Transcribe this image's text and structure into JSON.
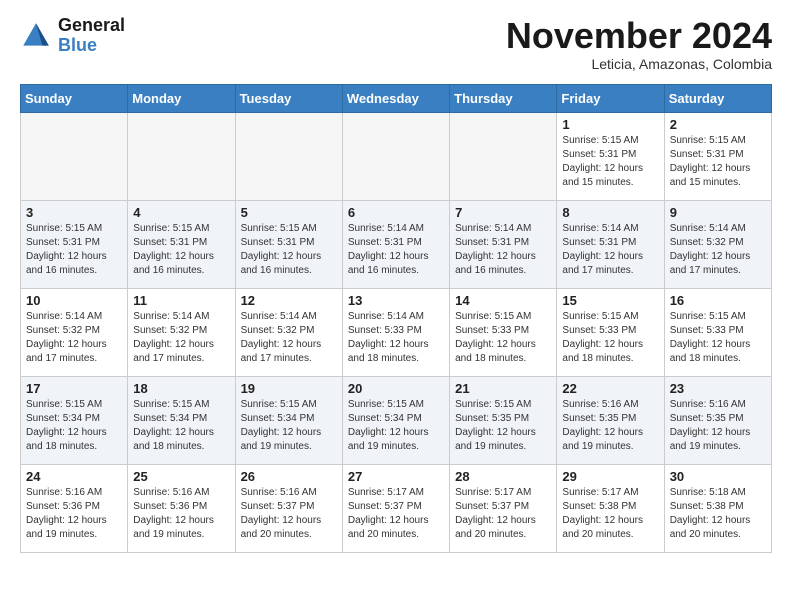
{
  "header": {
    "logo_line1": "General",
    "logo_line2": "Blue",
    "month": "November 2024",
    "location": "Leticia, Amazonas, Colombia"
  },
  "days_of_week": [
    "Sunday",
    "Monday",
    "Tuesday",
    "Wednesday",
    "Thursday",
    "Friday",
    "Saturday"
  ],
  "weeks": [
    [
      {
        "day": "",
        "info": ""
      },
      {
        "day": "",
        "info": ""
      },
      {
        "day": "",
        "info": ""
      },
      {
        "day": "",
        "info": ""
      },
      {
        "day": "",
        "info": ""
      },
      {
        "day": "1",
        "info": "Sunrise: 5:15 AM\nSunset: 5:31 PM\nDaylight: 12 hours\nand 15 minutes."
      },
      {
        "day": "2",
        "info": "Sunrise: 5:15 AM\nSunset: 5:31 PM\nDaylight: 12 hours\nand 15 minutes."
      }
    ],
    [
      {
        "day": "3",
        "info": "Sunrise: 5:15 AM\nSunset: 5:31 PM\nDaylight: 12 hours\nand 16 minutes."
      },
      {
        "day": "4",
        "info": "Sunrise: 5:15 AM\nSunset: 5:31 PM\nDaylight: 12 hours\nand 16 minutes."
      },
      {
        "day": "5",
        "info": "Sunrise: 5:15 AM\nSunset: 5:31 PM\nDaylight: 12 hours\nand 16 minutes."
      },
      {
        "day": "6",
        "info": "Sunrise: 5:14 AM\nSunset: 5:31 PM\nDaylight: 12 hours\nand 16 minutes."
      },
      {
        "day": "7",
        "info": "Sunrise: 5:14 AM\nSunset: 5:31 PM\nDaylight: 12 hours\nand 16 minutes."
      },
      {
        "day": "8",
        "info": "Sunrise: 5:14 AM\nSunset: 5:31 PM\nDaylight: 12 hours\nand 17 minutes."
      },
      {
        "day": "9",
        "info": "Sunrise: 5:14 AM\nSunset: 5:32 PM\nDaylight: 12 hours\nand 17 minutes."
      }
    ],
    [
      {
        "day": "10",
        "info": "Sunrise: 5:14 AM\nSunset: 5:32 PM\nDaylight: 12 hours\nand 17 minutes."
      },
      {
        "day": "11",
        "info": "Sunrise: 5:14 AM\nSunset: 5:32 PM\nDaylight: 12 hours\nand 17 minutes."
      },
      {
        "day": "12",
        "info": "Sunrise: 5:14 AM\nSunset: 5:32 PM\nDaylight: 12 hours\nand 17 minutes."
      },
      {
        "day": "13",
        "info": "Sunrise: 5:14 AM\nSunset: 5:33 PM\nDaylight: 12 hours\nand 18 minutes."
      },
      {
        "day": "14",
        "info": "Sunrise: 5:15 AM\nSunset: 5:33 PM\nDaylight: 12 hours\nand 18 minutes."
      },
      {
        "day": "15",
        "info": "Sunrise: 5:15 AM\nSunset: 5:33 PM\nDaylight: 12 hours\nand 18 minutes."
      },
      {
        "day": "16",
        "info": "Sunrise: 5:15 AM\nSunset: 5:33 PM\nDaylight: 12 hours\nand 18 minutes."
      }
    ],
    [
      {
        "day": "17",
        "info": "Sunrise: 5:15 AM\nSunset: 5:34 PM\nDaylight: 12 hours\nand 18 minutes."
      },
      {
        "day": "18",
        "info": "Sunrise: 5:15 AM\nSunset: 5:34 PM\nDaylight: 12 hours\nand 18 minutes."
      },
      {
        "day": "19",
        "info": "Sunrise: 5:15 AM\nSunset: 5:34 PM\nDaylight: 12 hours\nand 19 minutes."
      },
      {
        "day": "20",
        "info": "Sunrise: 5:15 AM\nSunset: 5:34 PM\nDaylight: 12 hours\nand 19 minutes."
      },
      {
        "day": "21",
        "info": "Sunrise: 5:15 AM\nSunset: 5:35 PM\nDaylight: 12 hours\nand 19 minutes."
      },
      {
        "day": "22",
        "info": "Sunrise: 5:16 AM\nSunset: 5:35 PM\nDaylight: 12 hours\nand 19 minutes."
      },
      {
        "day": "23",
        "info": "Sunrise: 5:16 AM\nSunset: 5:35 PM\nDaylight: 12 hours\nand 19 minutes."
      }
    ],
    [
      {
        "day": "24",
        "info": "Sunrise: 5:16 AM\nSunset: 5:36 PM\nDaylight: 12 hours\nand 19 minutes."
      },
      {
        "day": "25",
        "info": "Sunrise: 5:16 AM\nSunset: 5:36 PM\nDaylight: 12 hours\nand 19 minutes."
      },
      {
        "day": "26",
        "info": "Sunrise: 5:16 AM\nSunset: 5:37 PM\nDaylight: 12 hours\nand 20 minutes."
      },
      {
        "day": "27",
        "info": "Sunrise: 5:17 AM\nSunset: 5:37 PM\nDaylight: 12 hours\nand 20 minutes."
      },
      {
        "day": "28",
        "info": "Sunrise: 5:17 AM\nSunset: 5:37 PM\nDaylight: 12 hours\nand 20 minutes."
      },
      {
        "day": "29",
        "info": "Sunrise: 5:17 AM\nSunset: 5:38 PM\nDaylight: 12 hours\nand 20 minutes."
      },
      {
        "day": "30",
        "info": "Sunrise: 5:18 AM\nSunset: 5:38 PM\nDaylight: 12 hours\nand 20 minutes."
      }
    ]
  ]
}
